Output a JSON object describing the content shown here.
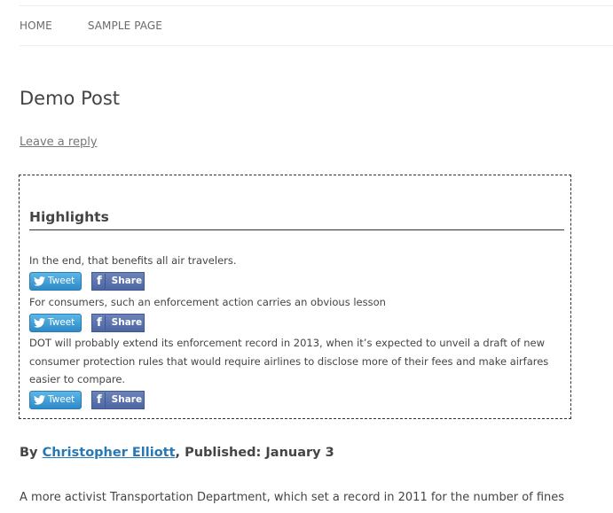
{
  "nav": {
    "items": [
      {
        "label": "HOME"
      },
      {
        "label": "SAMPLE PAGE"
      }
    ]
  },
  "post": {
    "title": "Demo Post",
    "reply_link": "Leave a reply"
  },
  "highlights": {
    "heading": "Highlights",
    "items": [
      {
        "text": "In the end, that benefits all air travelers."
      },
      {
        "text": "For consumers, such an enforcement action carries an obvious lesson"
      },
      {
        "text": "DOT will probably extend its enforcement record in 2013, when it’s expected to unveil a draft of new consumer protection rules that would require airlines to disclose more of their fees and make airfares easier to compare."
      }
    ],
    "tweet_label": "Tweet",
    "share_label": "Share",
    "colors": {
      "tweet": "#2e8ac9",
      "share": "#4e66a1"
    }
  },
  "byline": {
    "prefix": "By ",
    "author": "Christopher Elliott",
    "separator": ", Published: ",
    "date": "January 3"
  },
  "body": {
    "first_line": "A more activist Transportation Department, which set a record in 2011 for the number of fines"
  },
  "colors": {
    "link": "#2778b5",
    "text": "#444444"
  }
}
